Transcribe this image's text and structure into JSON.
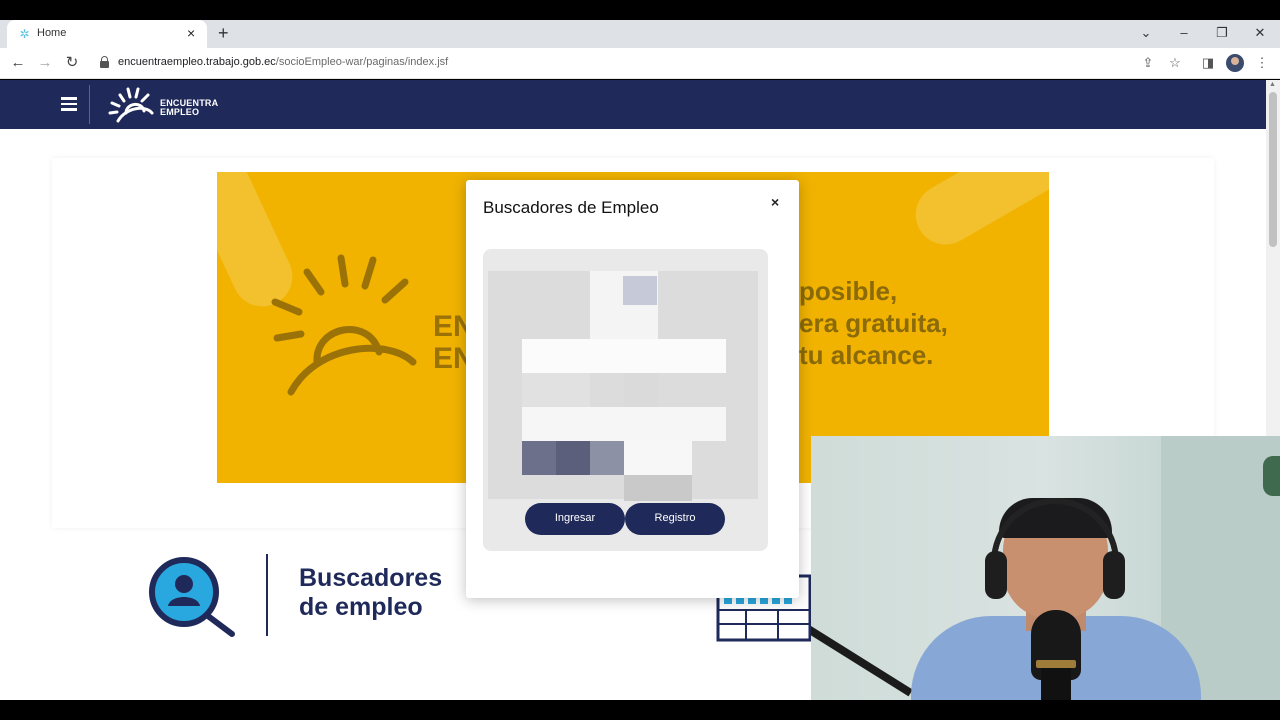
{
  "browser": {
    "tab_title": "Home",
    "tab_close": "×",
    "new_tab": "+",
    "url_host": "encuentraempleo.trabajo.gob.ec",
    "url_path": "/socioEmpleo-war/paginas/index.jsf",
    "window_controls": {
      "dropdown": "⌄",
      "minimize": "–",
      "restore": "❐",
      "close": "✕"
    }
  },
  "site": {
    "logo_line1": "ENCUENTRA",
    "logo_line2": "EMPLEO",
    "brand_color": "#1f2a5a",
    "banner_color": "#f1b300"
  },
  "banner": {
    "en_line1": "EN",
    "en_line2": "EN",
    "line1": "posible,",
    "line2": "era gratuita,",
    "line3": "tu alcance."
  },
  "section": {
    "title_line1": "Buscadores",
    "title_line2": "de empleo"
  },
  "modal": {
    "title": "Buscadores de Empleo",
    "close": "×",
    "login_button": "Ingresar",
    "register_button": "Registro"
  }
}
